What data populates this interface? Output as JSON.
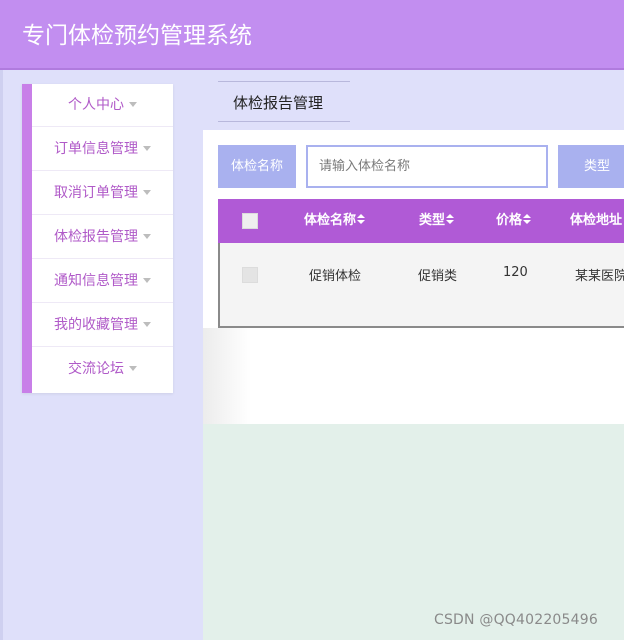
{
  "app": {
    "title": "专门体检预约管理系统"
  },
  "sidebar": {
    "items": [
      {
        "label": "个人中心"
      },
      {
        "label": "订单信息管理"
      },
      {
        "label": "取消订单管理"
      },
      {
        "label": "体检报告管理"
      },
      {
        "label": "通知信息管理"
      },
      {
        "label": "我的收藏管理"
      },
      {
        "label": "交流论坛"
      }
    ]
  },
  "breadcrumb": {
    "current": "体检报告管理"
  },
  "search": {
    "name_label": "体检名称",
    "name_placeholder": "请输入体检名称",
    "type_label": "类型"
  },
  "table": {
    "columns": [
      "体检名称",
      "类型",
      "价格",
      "体检地址"
    ],
    "rows": [
      [
        "促销体检",
        "促销类",
        "120",
        "某某医院"
      ]
    ]
  },
  "watermark": {
    "text": "CSDN @QQ402205496"
  },
  "colors": {
    "header": "#c28ef0",
    "sidebar_accent": "#c87fe8",
    "search_label": "#a9b1ef",
    "table_header": "#b05ad6",
    "background": "#dfe0fa",
    "content_bottom": "#e3f0ea"
  }
}
